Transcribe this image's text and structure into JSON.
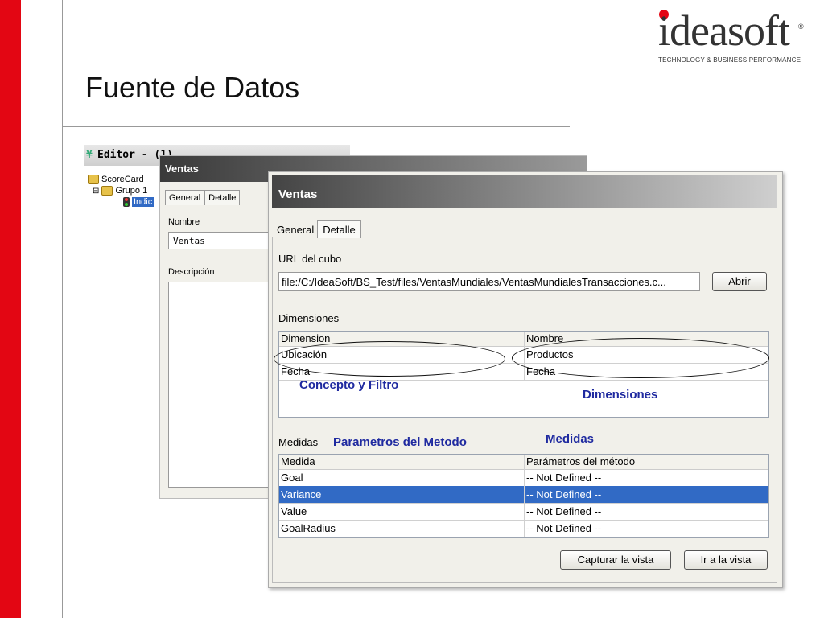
{
  "slide": {
    "title": "Fuente de Datos"
  },
  "logo": {
    "word": "ideasoft",
    "tagline": "TECHNOLOGY & BUSINESS PERFORMANCE",
    "registered": "®"
  },
  "editor": {
    "title": "Editor - (1)",
    "tree": [
      "ScoreCard",
      "Grupo 1",
      "Indic"
    ]
  },
  "window_back": {
    "title": "Ventas",
    "tabs": [
      "General",
      "Detalle"
    ],
    "nombre_label": "Nombre",
    "nombre_value": "Ventas",
    "descripcion_label": "Descripción"
  },
  "window_front": {
    "title": "Ventas",
    "tabs": {
      "general": "General",
      "detalle": "Detalle"
    },
    "url_label": "URL del cubo",
    "url_value": "file:/C:/IdeaSoft/BS_Test/files/VentasMundiales/VentasMundialesTransacciones.c...",
    "abrir_button": "Abrir",
    "dimensiones_label": "Dimensiones",
    "dimensiones_table": {
      "columns": [
        "Dimension",
        "Nombre"
      ],
      "rows": [
        [
          "Ubicación",
          "Productos"
        ],
        [
          "Fecha",
          "Fecha"
        ]
      ]
    },
    "medidas_label": "Medidas",
    "medidas_table": {
      "columns": [
        "Medida",
        "Parámetros del método"
      ],
      "rows": [
        [
          "Goal",
          "-- Not Defined --"
        ],
        [
          "Variance",
          "-- Not Defined --"
        ],
        [
          "Value",
          "-- Not Defined --"
        ],
        [
          "GoalRadius",
          "-- Not Defined --"
        ]
      ],
      "selected_row": 1
    },
    "capturar_button": "Capturar la vista",
    "ir_button": "Ir a la vista"
  },
  "annotations": {
    "concepto": "Concepto y Filtro",
    "dimensiones": "Dimensiones",
    "parametros": "Parametros del Metodo",
    "medidas": "Medidas"
  },
  "colors": {
    "accent_red": "#e30613",
    "selection_blue": "#316ac5",
    "annotation_blue": "#1f2aa0"
  }
}
